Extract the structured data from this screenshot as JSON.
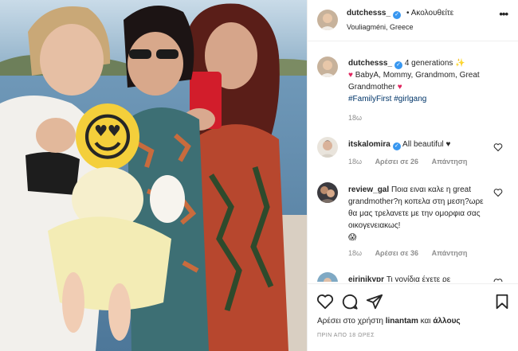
{
  "header": {
    "username": "dutchesss_",
    "separator": "•",
    "follow_label": "Ακολουθείτε",
    "location": "Vouliagméni, Greece",
    "more_label": "•••"
  },
  "caption": {
    "username": "dutchesss_",
    "line1": "4 generations",
    "sparkle": "✨",
    "heart": "♥",
    "body": "BabyA, Mommy, Grandmom, Great Grandmother",
    "hashtags": "#FamilyFirst #girlgang",
    "time": "18ω"
  },
  "comments": [
    {
      "username": "itskalomira",
      "text": "All beautiful ♥",
      "time": "18ω",
      "likes": "Αρέσει σε 26",
      "reply": "Απάντηση"
    },
    {
      "username": "review_gal",
      "text": "Ποια ειναι καλε η great grandmother?η κοπελα στη μεση?ωρε θα μας τρελανετε με την ομορφια σας οικογενειακως!",
      "emoji": "😱",
      "time": "18ω",
      "likes": "Αρέσει σε 36",
      "reply": "Απάντηση"
    },
    {
      "username": "eirinikypr",
      "text": "Τι γονίδια έχετε ρε"
    }
  ],
  "footer": {
    "liked_prefix": "Αρέσει στο χρήστη",
    "liked_user": "linantam",
    "liked_and": "και",
    "liked_others": "άλλους",
    "post_age": "ΠΡΙΝ ΑΠΟ 18 ΩΡΕΣ"
  },
  "photo": {
    "face_cover_emoji": "😍"
  },
  "colors": {
    "verified": "#3897f0",
    "hashtag": "#003569",
    "heart": "#e0245e",
    "muted": "#8e8e8e"
  }
}
